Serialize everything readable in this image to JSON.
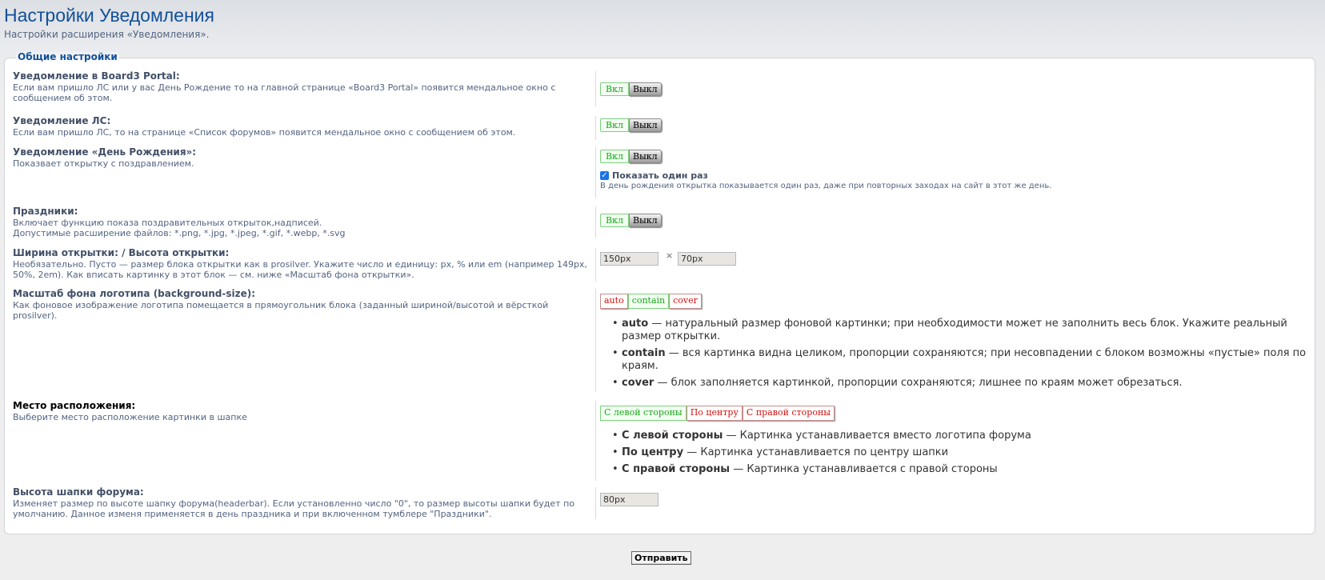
{
  "header": {
    "title": "Настройки Уведомления",
    "description": "Настройки расширения «Уведомления»."
  },
  "fieldset": {
    "legend": "Общие настройки"
  },
  "toggle": {
    "on": "Вкл",
    "off": "Выкл"
  },
  "rows": {
    "portal": {
      "label": "Уведомление в Board3 Portal:",
      "desc": "Если вам пришло ЛС или у вас День Рождение то на главной странице «Board3 Portal» появится мендальное окно с сообщением об этом."
    },
    "pm": {
      "label": "Уведомление ЛС:",
      "desc": "Если вам пришло ЛС, то на странице «Список форумов» появится мендальное окно с сообщением об этом."
    },
    "birthday": {
      "label": "Уведомление «День Рождения»:",
      "desc": "Показвает открытку с поздравлением.",
      "checkbox_label": "Показать один раз",
      "checkbox_checked": true,
      "checkbox_help": "В день рождения открытка показывается один раз, даже при повторных заходах на сайт в этот же день."
    },
    "holidays": {
      "label": "Праздники:",
      "desc1": "Включает функцию показа поздравительных открыток,надписей.",
      "desc2": "Допустимые расширение файлов: *.png, *.jpg, *.jpeg, *.gif, *.webp, *.svg"
    },
    "size": {
      "label": "Ширина открытки:  / Высота открытки:",
      "desc": "Необязательно. Пусто — размер блока открытки как в prosilver. Укажите число и единицу: px, % или em (например 149px, 50%, 2em). Как вписать картинку в этот блок — см. ниже «Масштаб фона открытки».",
      "width_value": "150px",
      "separator": "×",
      "height_value": "70px"
    },
    "bgsize": {
      "label": "Масштаб фона логотипа (background-size):",
      "desc": "Как фоновое изображение логотипа помещается в прямоугольник блока (заданный шириной/высотой и вёрсткой prosilver).",
      "options": [
        "auto",
        "contain",
        "cover"
      ],
      "selected": "contain",
      "bullets": [
        {
          "term": "auto",
          "text": " — натуральный размер фоновой картинки; при необходимости может не заполнить весь блок. Укажите реальный размер открытки."
        },
        {
          "term": "contain",
          "text": " — вся картинка видна целиком, пропорции сохраняются; при несовпадении с блоком возможны «пустые» поля по краям."
        },
        {
          "term": "cover",
          "text": " — блок заполняется картинкой, пропорции сохраняются; лишнее по краям может обрезаться."
        }
      ]
    },
    "position": {
      "label": "Место расположения:",
      "desc": "Выберите место расположение картинки в шапке",
      "options": [
        "С левой стороны",
        "По центру",
        "С правой стороны"
      ],
      "selected": "С левой стороны",
      "bullets": [
        {
          "term": "С левой стороны",
          "text": " — Картинка устанавливается вместо логотипа форума"
        },
        {
          "term": "По центру",
          "text": " — Картинка устанавливается по центру шапки"
        },
        {
          "term": "С правой стороны",
          "text": " — Картинка устанавливается с правой стороны"
        }
      ]
    },
    "headerheight": {
      "label": "Высота шапки форума:",
      "desc": "Изменяет размер по высоте шапку форума(headerbar). Если установленно число \"0\", то размер высоты шапки будет по умолчанию. Данное изменя применяется в день праздника и при включенном тумблере \"Праздники\".",
      "value": "80px"
    }
  },
  "submit_label": "Отправить"
}
